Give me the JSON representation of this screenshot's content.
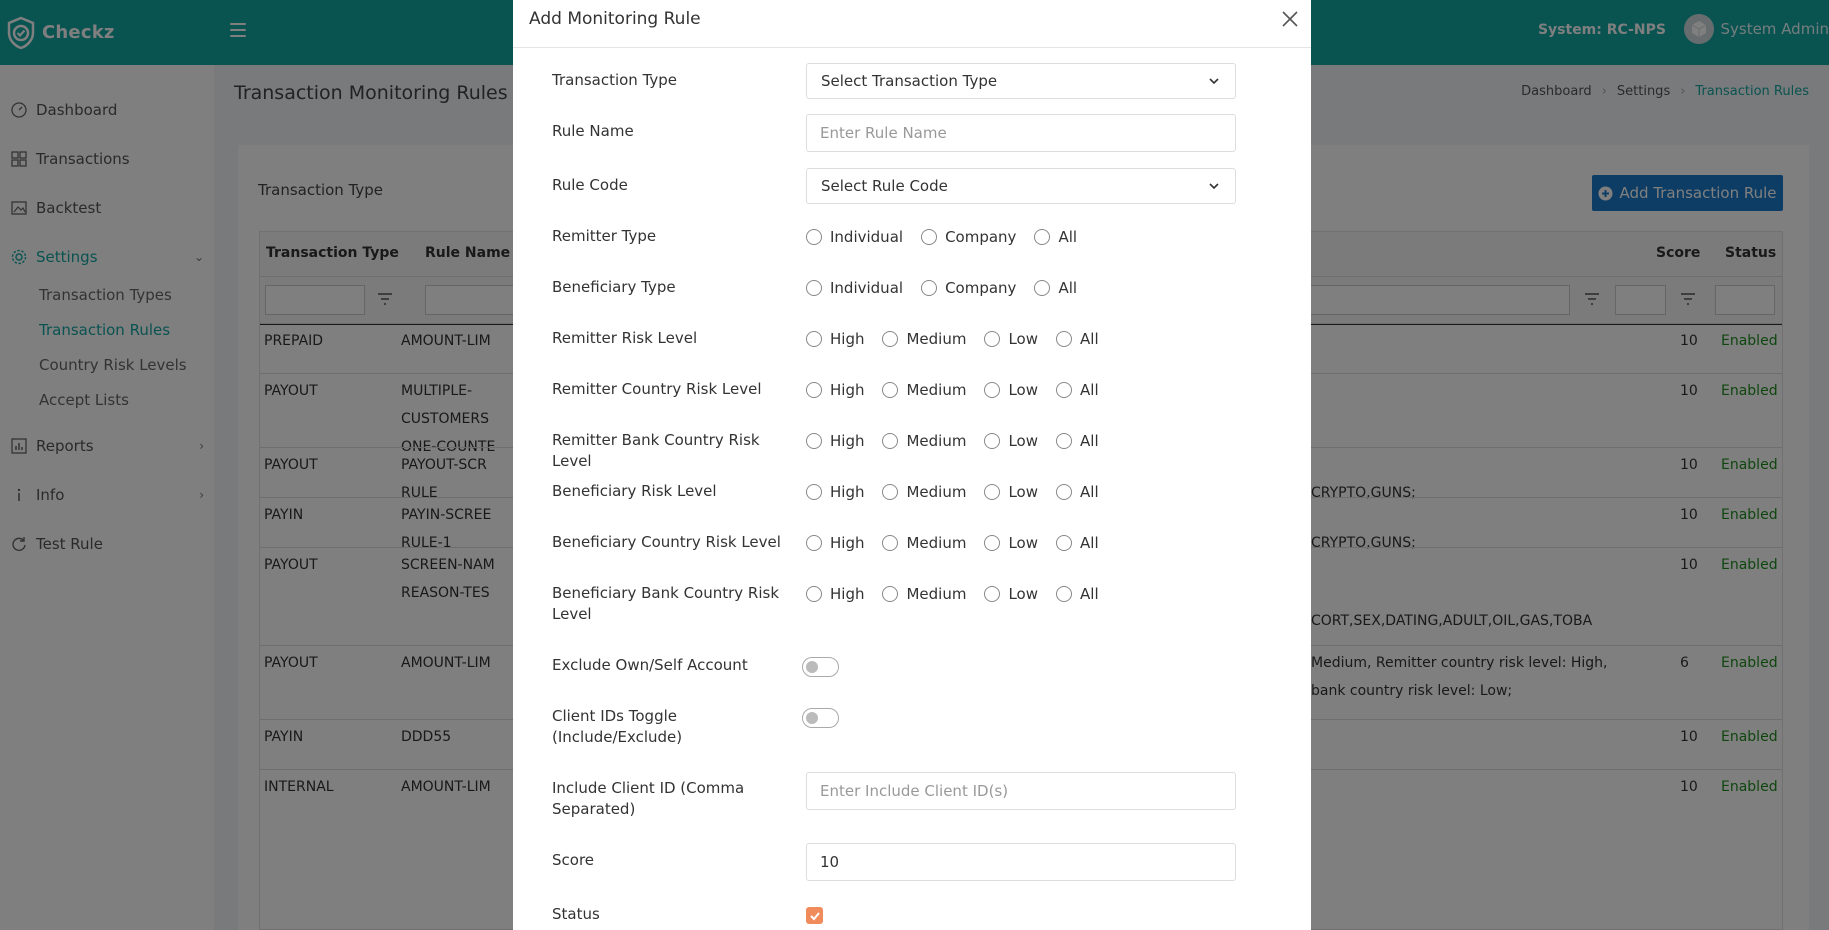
{
  "app": {
    "name": "Checkz",
    "system": "System: RC-NPS",
    "user": "System Admin"
  },
  "sidebar": {
    "items": [
      {
        "label": "Dashboard"
      },
      {
        "label": "Transactions"
      },
      {
        "label": "Backtest"
      },
      {
        "label": "Settings"
      },
      {
        "label": "Reports"
      },
      {
        "label": "Info"
      },
      {
        "label": "Test Rule"
      }
    ],
    "settings_sub": [
      "Transaction Types",
      "Transaction Rules",
      "Country Risk Levels",
      "Accept Lists"
    ]
  },
  "page": {
    "title": "Transaction Monitoring Rules",
    "breadcrumb": [
      "Dashboard",
      "Settings",
      "Transaction Rules"
    ],
    "transaction_type_label": "Transaction Type",
    "add_button": "Add Transaction Rule"
  },
  "table": {
    "headers": {
      "type": "Transaction Type",
      "name": "Rule Name",
      "score": "Score",
      "status": "Status"
    },
    "rows": [
      {
        "type": "PREPAID",
        "name": [
          "AMOUNT-LIM"
        ],
        "desc": [],
        "score": "10",
        "status": "Enabled"
      },
      {
        "type": "PAYOUT",
        "name": [
          "MULTIPLE-",
          "CUSTOMERS",
          "ONE-COUNTE"
        ],
        "desc": [],
        "score": "10",
        "status": "Enabled"
      },
      {
        "type": "PAYOUT",
        "name": [
          "PAYOUT-SCR",
          "RULE"
        ],
        "desc": [
          "",
          "CRYPTO,GUNS;"
        ],
        "score": "10",
        "status": "Enabled"
      },
      {
        "type": "PAYIN",
        "name": [
          "PAYIN-SCREE",
          "RULE-1"
        ],
        "desc": [
          "",
          "CRYPTO,GUNS;"
        ],
        "score": "10",
        "status": "Enabled"
      },
      {
        "type": "PAYOUT",
        "name": [
          "SCREEN-NAM",
          "REASON-TES"
        ],
        "desc": [
          "",
          "",
          "CORT,SEX,DATING,ADULT,OIL,GAS,TOBA"
        ],
        "score": "10",
        "status": "Enabled"
      },
      {
        "type": "PAYOUT",
        "name": [
          "AMOUNT-LIM"
        ],
        "desc": [
          "Medium, Remitter country risk level: High,",
          "bank country risk level: Low;"
        ],
        "score": "6",
        "status": "Enabled"
      },
      {
        "type": "PAYIN",
        "name": [
          "DDD55"
        ],
        "desc": [],
        "score": "10",
        "status": "Enabled"
      },
      {
        "type": "INTERNAL",
        "name": [
          "AMOUNT-LIM"
        ],
        "desc": [],
        "score": "10",
        "status": "Enabled"
      }
    ]
  },
  "modal": {
    "title": "Add Monitoring Rule",
    "fields": {
      "transaction_type": {
        "label": "Transaction Type",
        "value": "Select Transaction Type"
      },
      "rule_name": {
        "label": "Rule Name",
        "placeholder": "Enter Rule Name"
      },
      "rule_code": {
        "label": "Rule Code",
        "value": "Select Rule Code"
      },
      "remitter_type": {
        "label": "Remitter Type"
      },
      "beneficiary_type": {
        "label": "Beneficiary Type"
      },
      "remitter_risk": {
        "label": "Remitter Risk Level"
      },
      "remitter_country_risk": {
        "label": "Remitter Country Risk Level"
      },
      "remitter_bank_country_risk": {
        "label": "Remitter Bank Country Risk Level"
      },
      "beneficiary_risk": {
        "label": "Beneficiary Risk Level"
      },
      "beneficiary_country_risk": {
        "label": "Beneficiary Country Risk Level"
      },
      "beneficiary_bank_country_risk": {
        "label": "Beneficiary Bank Country Risk Level"
      },
      "exclude_own": {
        "label": "Exclude Own/Self Account",
        "on": false
      },
      "client_ids_toggle": {
        "label": "Client IDs Toggle (Include/Exclude)",
        "on": false
      },
      "include_client_id": {
        "label": "Include Client ID (Comma Separated)",
        "placeholder": "Enter Include Client ID(s)"
      },
      "score": {
        "label": "Score",
        "value": "10"
      },
      "status": {
        "label": "Status",
        "checked": true
      }
    },
    "type_options": [
      "Individual",
      "Company",
      "All"
    ],
    "risk_options": [
      "High",
      "Medium",
      "Low",
      "All"
    ]
  },
  "colors": {
    "brand": "#12a6a3",
    "primary_button": "#1a7ac8",
    "enabled": "#1e8c1e",
    "checkbox": "#f08c5c"
  }
}
